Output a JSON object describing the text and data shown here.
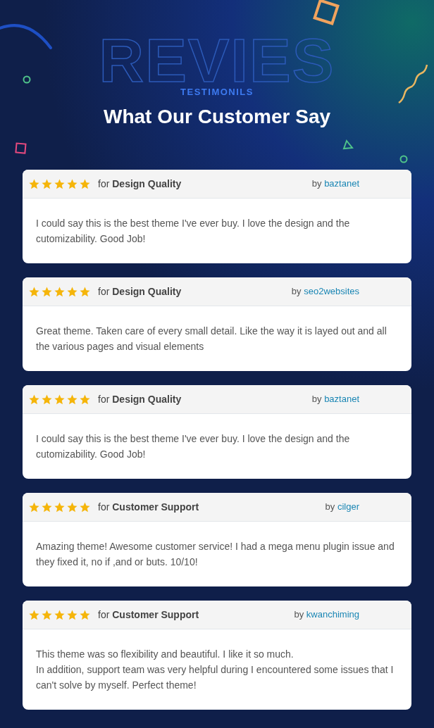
{
  "header": {
    "watermark_title": "REVIES",
    "eyebrow": "TESTIMONILS",
    "title": "What Our Customer Say"
  },
  "reviews": [
    {
      "stars": 5,
      "for_label": "for",
      "category": "Design Quality",
      "by_label": "by",
      "author": "baztanet",
      "paragraphs": [
        "I could say this is the best theme I've ever buy. I love the design and the cutomizability. Good Job!"
      ]
    },
    {
      "stars": 5,
      "for_label": "for",
      "category": "Design Quality",
      "by_label": "by",
      "author": "seo2websites",
      "paragraphs": [
        "Great theme. Taken care of every small detail. Like the way it is layed out and all the various pages and visual elements"
      ]
    },
    {
      "stars": 5,
      "for_label": "for",
      "category": "Design Quality",
      "by_label": "by",
      "author": "baztanet",
      "paragraphs": [
        "I could say this is the best theme I've ever buy. I love the design and the cutomizability. Good Job!"
      ]
    },
    {
      "stars": 5,
      "for_label": "for",
      "category": "Customer Support",
      "by_label": "by",
      "author": "cilger",
      "paragraphs": [
        "Amazing theme! Awesome customer service! I had a mega menu plugin issue and they fixed it, no if ,and or buts. 10/10!"
      ]
    },
    {
      "stars": 5,
      "for_label": "for",
      "category": "Customer Support",
      "by_label": "by",
      "author": "kwanchiming",
      "paragraphs": [
        "This theme was so flexibility and beautiful. I like it so much.",
        "In addition, support team was very helpful during I encountered some issues that I can't solve by myself. Perfect theme!"
      ]
    }
  ]
}
